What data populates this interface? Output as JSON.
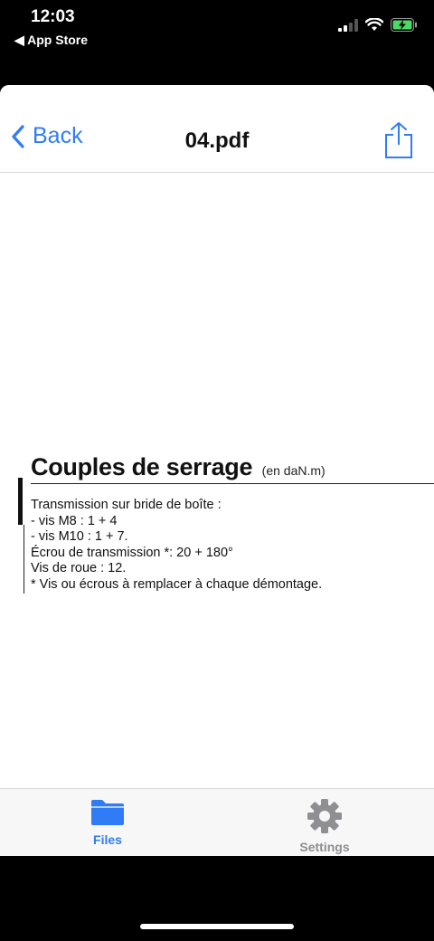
{
  "status": {
    "time": "12:03",
    "back_app": "◀ App Store"
  },
  "nav": {
    "back_label": "Back",
    "title": "04.pdf",
    "share": "share-icon"
  },
  "document": {
    "title": "Couples de serrage",
    "unit": "(en daN.m)",
    "lines": [
      "Transmission sur bride de boîte :",
      "- vis M8 : 1 + 4",
      "- vis M10 : 1 + 7.",
      "Écrou de transmission *: 20 + 180°",
      "Vis de roue : 12.",
      "* Vis ou écrous à remplacer à chaque démontage."
    ]
  },
  "tabs": [
    {
      "label": "Files",
      "icon": "folder-icon",
      "active": true
    },
    {
      "label": "Settings",
      "icon": "gear-icon",
      "active": false
    }
  ],
  "colors": {
    "accent": "#2f7cf6",
    "inactive": "#8e8e93"
  }
}
